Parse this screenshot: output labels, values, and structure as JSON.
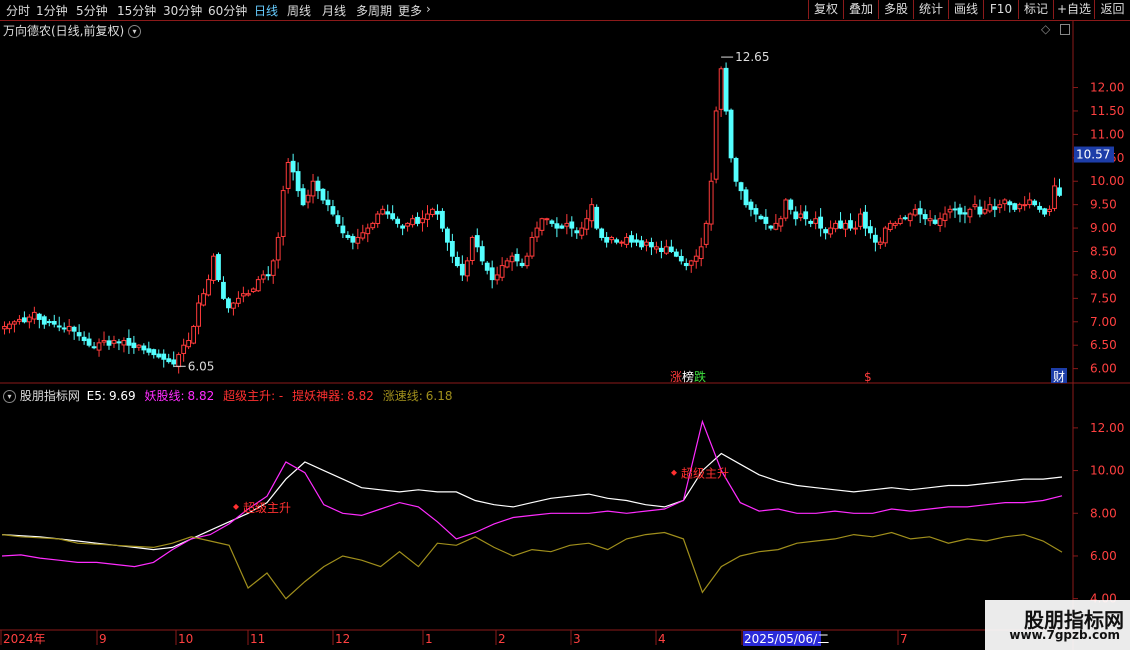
{
  "toolbar": {
    "periods": [
      "分时",
      "1分钟",
      "5分钟",
      "15分钟",
      "30分钟",
      "60分钟",
      "日线",
      "周线",
      "月线",
      "多周期",
      "更多"
    ],
    "active_period": "日线",
    "buttons": [
      "复权",
      "叠加",
      "多股",
      "统计",
      "画线",
      "F10",
      "标记",
      "+自选",
      "返回"
    ]
  },
  "main_title": "万向德农(日线,前复权)",
  "indicator": {
    "name": "股朋指标网",
    "e5_label": "E5:",
    "e5_value": "9.69",
    "yaoline_label": "妖股线:",
    "yaoline_value": "8.82",
    "zhusheng_label": "超级主升: -",
    "tiyao_label": "提妖神器:",
    "tiyao_value": "8.82",
    "zhangsu_label": "涨速线:",
    "zhangsu_value": "6.18",
    "annotation": "超级主升"
  },
  "colors": {
    "up": "#ff3b3b",
    "down": "#54ffff",
    "e5": "#ffffff",
    "yao": "#ff2cff",
    "zs": "#a08f1c",
    "annotation": "#ff3030",
    "axis": "#8b1a1a",
    "date_box": "#2b2bd9"
  },
  "chart_data": [
    {
      "type": "candlestick",
      "title": "万向德农(日线,前复权)",
      "ylim": [
        5.8,
        13.1
      ],
      "yticks": [
        "12.00",
        "11.50",
        "11.00",
        "10.50",
        "10.00",
        "9.50",
        "9.00",
        "8.50",
        "8.00",
        "7.50",
        "7.00",
        "6.50",
        "6.00"
      ],
      "last_price": "10.57",
      "annotations": [
        {
          "text": "12.65",
          "kind": "high"
        },
        {
          "text": "6.05",
          "kind": "low"
        }
      ],
      "event_markers": [
        {
          "text": "涨",
          "color": "#ff3b3b"
        },
        {
          "text": "榜",
          "color": "#ffffff"
        },
        {
          "text": "跌",
          "color": "#3fe03f"
        },
        {
          "text": "$",
          "color": "#ff3b3b"
        },
        {
          "text": "财",
          "color": "#ffffff"
        }
      ],
      "close_path": [
        6.9,
        6.95,
        7.0,
        7.05,
        7.0,
        7.1,
        7.2,
        7.05,
        6.95,
        7.0,
        6.95,
        6.9,
        6.85,
        6.9,
        6.8,
        6.7,
        6.6,
        6.5,
        6.45,
        6.55,
        6.6,
        6.5,
        6.6,
        6.55,
        6.6,
        6.5,
        6.45,
        6.5,
        6.4,
        6.35,
        6.3,
        6.25,
        6.2,
        6.15,
        6.1,
        6.3,
        6.5,
        6.6,
        6.9,
        7.4,
        7.6,
        7.9,
        8.4,
        7.9,
        7.5,
        7.3,
        7.4,
        7.5,
        7.6,
        7.6,
        7.7,
        7.9,
        8.0,
        8.0,
        8.3,
        8.8,
        9.8,
        10.4,
        10.2,
        9.8,
        9.5,
        9.7,
        10.0,
        9.8,
        9.6,
        9.5,
        9.3,
        9.1,
        8.9,
        8.8,
        8.7,
        8.8,
        8.9,
        9.0,
        9.1,
        9.3,
        9.4,
        9.3,
        9.2,
        9.1,
        9.0,
        9.1,
        9.2,
        9.1,
        9.2,
        9.3,
        9.4,
        9.3,
        9.0,
        8.7,
        8.4,
        8.2,
        8.0,
        8.3,
        8.8,
        8.6,
        8.3,
        8.1,
        7.9,
        8.0,
        8.2,
        8.3,
        8.4,
        8.3,
        8.2,
        8.4,
        8.8,
        9.0,
        9.2,
        9.2,
        9.1,
        9.0,
        9.0,
        9.1,
        9.0,
        8.9,
        9.0,
        9.2,
        9.5,
        9.0,
        8.8,
        8.7,
        8.8,
        8.7,
        8.7,
        8.8,
        8.7,
        8.7,
        8.6,
        8.7,
        8.6,
        8.6,
        8.5,
        8.6,
        8.5,
        8.4,
        8.3,
        8.2,
        8.3,
        8.4,
        8.6,
        9.1,
        10.0,
        11.5,
        12.4,
        11.5,
        10.5,
        10.0,
        9.8,
        9.5,
        9.4,
        9.3,
        9.2,
        9.1,
        9.0,
        9.1,
        9.2,
        9.6,
        9.4,
        9.2,
        9.3,
        9.2,
        9.1,
        9.2,
        9.0,
        8.9,
        9.0,
        9.1,
        9.0,
        9.1,
        9.0,
        9.0,
        9.3,
        9.0,
        8.9,
        8.7,
        8.7,
        9.0,
        9.1,
        9.1,
        9.2,
        9.2,
        9.3,
        9.4,
        9.3,
        9.2,
        9.2,
        9.1,
        9.2,
        9.3,
        9.4,
        9.4,
        9.3,
        9.3,
        9.4,
        9.5,
        9.3,
        9.4,
        9.5,
        9.4,
        9.5,
        9.6,
        9.5,
        9.4,
        9.5,
        9.5,
        9.6,
        9.5,
        9.4,
        9.3,
        9.4,
        9.9,
        9.7
      ]
    },
    {
      "type": "line",
      "ylim": [
        3.0,
        13.4
      ],
      "yticks": [
        "12.00",
        "10.00",
        "8.00",
        "6.00",
        "4.00"
      ],
      "series": [
        {
          "name": "E5",
          "color": "#ffffff",
          "values": [
            7.0,
            6.95,
            6.9,
            6.8,
            6.7,
            6.6,
            6.5,
            6.4,
            6.3,
            6.4,
            6.8,
            7.2,
            7.6,
            8.0,
            8.5,
            9.6,
            10.4,
            10.0,
            9.6,
            9.2,
            9.1,
            9.0,
            9.1,
            9.0,
            9.0,
            8.6,
            8.4,
            8.3,
            8.5,
            8.7,
            8.8,
            8.9,
            8.7,
            8.6,
            8.4,
            8.3,
            8.6,
            10.0,
            10.8,
            10.3,
            9.8,
            9.5,
            9.3,
            9.2,
            9.1,
            9.0,
            9.1,
            9.2,
            9.1,
            9.2,
            9.3,
            9.3,
            9.4,
            9.5,
            9.6,
            9.6,
            9.7
          ]
        },
        {
          "name": "妖股线",
          "color": "#ff2cff",
          "values": [
            6.0,
            6.05,
            5.9,
            5.8,
            5.7,
            5.7,
            5.6,
            5.5,
            5.7,
            6.3,
            6.8,
            7.0,
            7.5,
            8.2,
            8.8,
            10.4,
            9.9,
            8.4,
            8.0,
            7.9,
            8.2,
            8.5,
            8.3,
            7.6,
            6.8,
            7.1,
            7.5,
            7.8,
            7.9,
            8.0,
            8.0,
            8.0,
            8.1,
            8.0,
            8.1,
            8.2,
            8.6,
            12.3,
            10.0,
            8.5,
            8.1,
            8.2,
            8.0,
            8.0,
            8.1,
            8.0,
            8.0,
            8.2,
            8.1,
            8.2,
            8.3,
            8.3,
            8.4,
            8.5,
            8.5,
            8.6,
            8.82
          ]
        },
        {
          "name": "涨速线",
          "color": "#a08f1c",
          "values": [
            7.0,
            6.9,
            6.85,
            6.8,
            6.6,
            6.55,
            6.5,
            6.45,
            6.4,
            6.6,
            6.9,
            6.7,
            6.5,
            4.5,
            5.2,
            4.0,
            4.8,
            5.5,
            6.0,
            5.8,
            5.5,
            6.2,
            5.5,
            6.6,
            6.5,
            6.9,
            6.4,
            6.0,
            6.3,
            6.2,
            6.5,
            6.6,
            6.3,
            6.8,
            7.0,
            7.1,
            6.8,
            4.3,
            5.5,
            6.0,
            6.2,
            6.3,
            6.6,
            6.7,
            6.8,
            7.0,
            6.9,
            7.1,
            6.8,
            6.9,
            6.6,
            6.8,
            6.7,
            6.9,
            7.0,
            6.7,
            6.18
          ]
        }
      ],
      "annotations": [
        "超级主升",
        "超级主升"
      ]
    }
  ],
  "date_axis": {
    "labels": [
      "2024年",
      "9",
      "10",
      "11",
      "12",
      "1",
      "2",
      "3",
      "4",
      "2025/05/06/二",
      "7"
    ]
  },
  "watermark": {
    "line1": "股朋指标网",
    "line2": "www.7gpzb.com"
  }
}
